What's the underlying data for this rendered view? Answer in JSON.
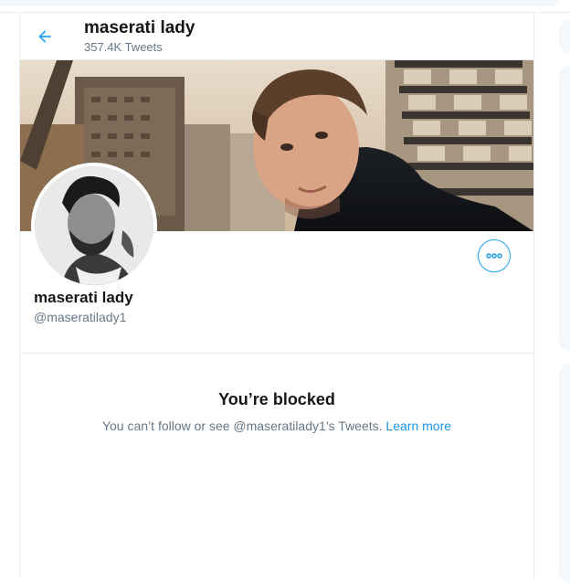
{
  "header": {
    "title": "maserati lady",
    "tweet_count": "357.4K Tweets"
  },
  "profile": {
    "display_name": "maserati lady",
    "handle": "@maseratilady1"
  },
  "blocked": {
    "title": "You’re blocked",
    "message": "You can’t follow or see @maseratilady1’s Tweets.",
    "link": "Learn more"
  },
  "colors": {
    "accent": "#1da1f2",
    "secondary_text": "#657786",
    "divider": "#e6ecf0"
  },
  "icons": {
    "back": "arrow-left-icon",
    "more": "more-horizontal-icon"
  }
}
